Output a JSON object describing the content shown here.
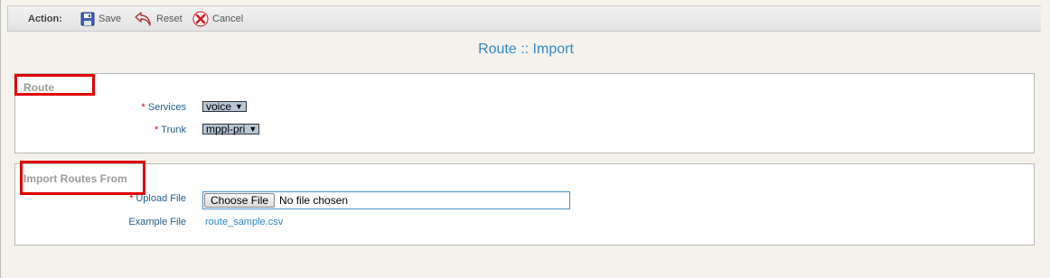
{
  "toolbar": {
    "action_label": "Action:",
    "save_label": "Save",
    "reset_label": "Reset",
    "cancel_label": "Cancel"
  },
  "page_title": "Route :: Import",
  "route_section": {
    "legend": "Route",
    "services": {
      "required_mark": "*",
      "label": "Services",
      "value": "voice"
    },
    "trunk": {
      "required_mark": "*",
      "label": "Trunk",
      "value": "mppl-pri"
    }
  },
  "import_section": {
    "legend": "Import Routes From",
    "upload": {
      "required_mark": "*",
      "label": "Upload File",
      "button_label": "Choose File",
      "status": "No file chosen"
    },
    "example": {
      "label": "Example File",
      "link_text": "route_sample.csv"
    }
  },
  "colors": {
    "highlight": "#e00000",
    "title": "#3489c4",
    "label": "#1f5d8c",
    "link": "#2a86c8",
    "required": "#d40000"
  }
}
